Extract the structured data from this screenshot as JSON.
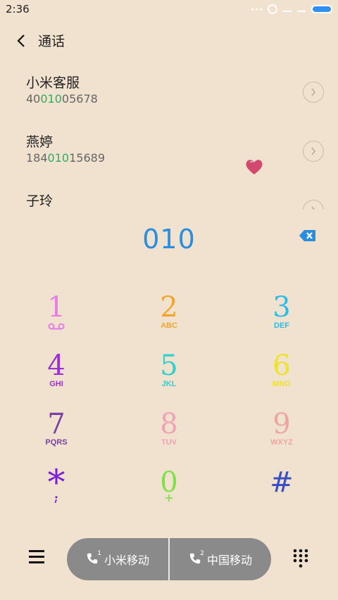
{
  "status_bar": {
    "time": "2:36"
  },
  "header": {
    "title": "通话"
  },
  "contacts": [
    {
      "name": "小米客服",
      "number_prefix": "40",
      "number_match": "010",
      "number_suffix": "05678"
    },
    {
      "name": "燕婷",
      "number_prefix": "184",
      "number_match": "010",
      "number_suffix": "15689"
    },
    {
      "name": "子玲",
      "number_prefix": "",
      "number_match": "",
      "number_suffix": ""
    }
  ],
  "dialer": {
    "input": "010"
  },
  "keypad": {
    "keys": [
      {
        "digit": "1",
        "letters": "",
        "color": "#e67ee6"
      },
      {
        "digit": "2",
        "letters": "ABC",
        "color": "#f1a52c"
      },
      {
        "digit": "3",
        "letters": "DEF",
        "color": "#2bbde8"
      },
      {
        "digit": "4",
        "letters": "GHI",
        "color": "#9d2fd6"
      },
      {
        "digit": "5",
        "letters": "JKL",
        "color": "#2fd0cd"
      },
      {
        "digit": "6",
        "letters": "MNO",
        "color": "#eee22a"
      },
      {
        "digit": "7",
        "letters": "PQRS",
        "color": "#7b3fa5"
      },
      {
        "digit": "8",
        "letters": "TUV",
        "color": "#f0a3b6"
      },
      {
        "digit": "9",
        "letters": "WXYZ",
        "color": "#eea7a0"
      },
      {
        "digit": "*",
        "letters": "",
        "color": "#7a20d6"
      },
      {
        "digit": "0",
        "letters": "",
        "color": "#7fe14a"
      },
      {
        "digit": "#",
        "letters": "",
        "color": "#3a4fc6"
      }
    ]
  },
  "bottom": {
    "sim1_label": "小米移动",
    "sim1_index": "1",
    "sim2_label": "中国移动",
    "sim2_index": "2"
  },
  "colors": {
    "background": "#f1e2cf",
    "match_highlight": "#2cae5e",
    "digits": "#2a8ee0",
    "delete": "#2a8ee0",
    "sim_buttons": "#8a8a8a"
  },
  "icons": {
    "back": "chevron-left-icon",
    "detail": "chevron-right-circle-icon",
    "delete": "backspace-icon",
    "menu": "hamburger-icon",
    "sim_call": "phone-icon",
    "keypad_toggle": "dialpad-icon",
    "voicemail": "voicemail-icon",
    "sticker": "heart-icon"
  }
}
